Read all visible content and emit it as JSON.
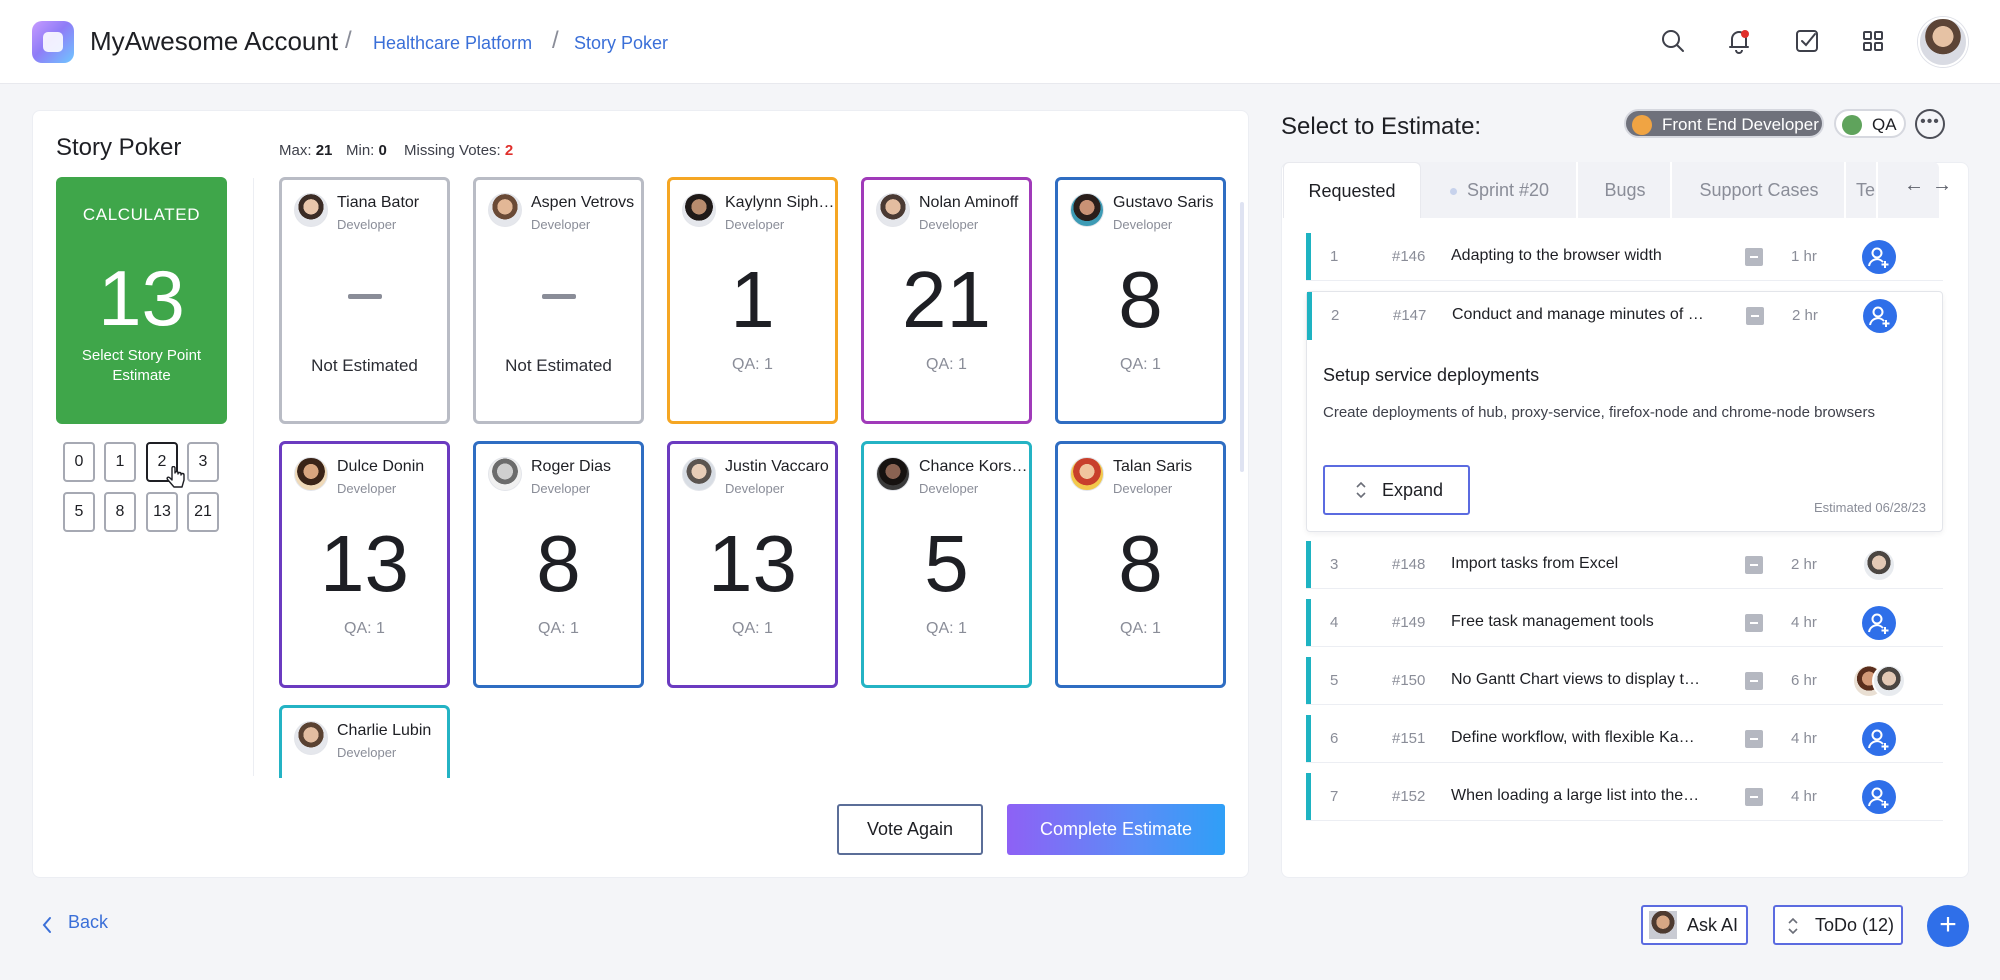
{
  "header": {
    "app_title": "MyAwesome Account",
    "breadcrumb": [
      "Healthcare Platform",
      "Story Poker"
    ],
    "icons": [
      "search-icon",
      "bell-icon",
      "checkbox-icon",
      "grid-icon",
      "avatar"
    ]
  },
  "story_poker": {
    "title": "Story Poker",
    "stats": {
      "max_label": "Max:",
      "max": "21",
      "min_label": "Min:",
      "min": "0",
      "missing_label": "Missing Votes:",
      "missing": "2"
    },
    "calculated": {
      "label": "CALCULATED",
      "value": "13",
      "subtitle": "Select Story Point Estimate"
    },
    "points": [
      "0",
      "1",
      "2",
      "3",
      "5",
      "8",
      "13",
      "21"
    ],
    "selected_point": "2",
    "cards": [
      {
        "name": "Tiana Bator",
        "role": "Developer",
        "value": "",
        "note": "Not Estimated",
        "color": "#b9bcc5"
      },
      {
        "name": "Aspen Vetrovs",
        "role": "Developer",
        "value": "",
        "note": "Not Estimated",
        "color": "#b9bcc5"
      },
      {
        "name": "Kaylynn Siphron",
        "role": "Developer",
        "value": "1",
        "note": "QA: 1",
        "color": "#f5a623"
      },
      {
        "name": "Nolan Aminoff",
        "role": "Developer",
        "value": "21",
        "note": "QA: 1",
        "color": "#a03ab9"
      },
      {
        "name": "Gustavo Saris",
        "role": "Developer",
        "value": "8",
        "note": "QA: 1",
        "color": "#2f6dc2"
      },
      {
        "name": "Dulce Donin",
        "role": "Developer",
        "value": "13",
        "note": "QA: 1",
        "color": "#6b3bc0"
      },
      {
        "name": "Roger Dias",
        "role": "Developer",
        "value": "8",
        "note": "QA: 1",
        "color": "#2f6dc2"
      },
      {
        "name": "Justin Vaccaro",
        "role": "Developer",
        "value": "13",
        "note": "QA: 1",
        "color": "#6b3bc0"
      },
      {
        "name": "Chance Korsgaard",
        "role": "Developer",
        "value": "5",
        "note": "QA: 1",
        "color": "#24b3c4"
      },
      {
        "name": "Talan Saris",
        "role": "Developer",
        "value": "8",
        "note": "QA: 1",
        "color": "#2f6dc2"
      },
      {
        "name": "Charlie Lubin",
        "role": "Developer",
        "value": "",
        "note": "",
        "color": "#24b3c4"
      }
    ],
    "vote_again": "Vote Again",
    "complete": "Complete Estimate"
  },
  "estimate": {
    "title": "Select to Estimate:",
    "chips": [
      "Front End Developer",
      "QA"
    ],
    "tabs": [
      "Requested",
      "Sprint #20",
      "Bugs",
      "Support Cases",
      "Te"
    ],
    "rows": [
      {
        "idx": "1",
        "id": "#146",
        "title": "Adapting to the browser width",
        "hours": "1 hr",
        "assignee": "add"
      },
      {
        "idx": "2",
        "id": "#147",
        "title": "Conduct and manage minutes of meetings",
        "hours": "2 hr",
        "assignee": "add"
      },
      {
        "idx": "3",
        "id": "#148",
        "title": "Import tasks from Excel",
        "hours": "2 hr",
        "assignee": "face"
      },
      {
        "idx": "4",
        "id": "#149",
        "title": "Free task management tools",
        "hours": "4 hr",
        "assignee": "add"
      },
      {
        "idx": "5",
        "id": "#150",
        "title": "No Gantt Chart views to display tasks",
        "hours": "6 hr",
        "assignee": "faces"
      },
      {
        "idx": "6",
        "id": "#151",
        "title": "Define workflow, with flexible Kanban boards",
        "hours": "4 hr",
        "assignee": "add"
      },
      {
        "idx": "7",
        "id": "#152",
        "title": "When loading a large list into the table",
        "hours": "4 hr",
        "assignee": "add"
      }
    ],
    "expanded": {
      "title": "Setup service deployments",
      "description": "Create deployments of hub, proxy-service, firefox-node and chrome-node browsers",
      "button": "Expand",
      "date": "Estimated 06/28/23"
    }
  },
  "footer": {
    "back": "Back",
    "ask_ai": "Ask AI",
    "todo": "ToDo (12)",
    "add": "+"
  },
  "colors": {
    "accent": "#2f6fe9",
    "calculated": "#3fa64a",
    "link": "#3a6fd8",
    "warning": "#e0302c",
    "task_bar": "#1eb3c2"
  }
}
